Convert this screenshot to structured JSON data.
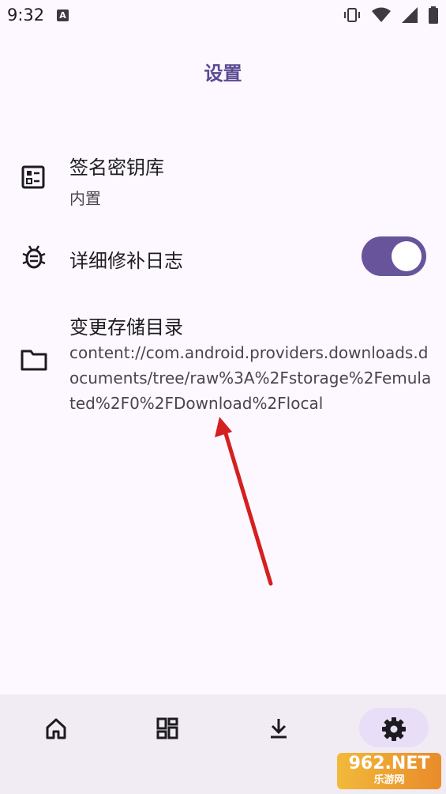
{
  "status_bar": {
    "time": "9:32",
    "notif_letter": "A"
  },
  "header": {
    "title": "设置"
  },
  "settings": [
    {
      "label": "签名密钥库",
      "value": "内置"
    },
    {
      "label": "详细修补日志",
      "toggle_on": true
    },
    {
      "label": "变更存储目录",
      "value": "content://com.android.providers.downloads.documents/tree/raw%3A%2Fstorage%2Femulated%2F0%2FDownload%2Flocal"
    }
  ],
  "bottom_nav": {
    "items": [
      "home-icon",
      "dashboard-icon",
      "download-icon",
      "settings-icon"
    ],
    "active": "settings"
  },
  "watermark": {
    "main": "962.NET",
    "sub": "乐游网"
  },
  "colors": {
    "accent": "#67549b",
    "title": "#5b4a93",
    "background": "#fdf7ff",
    "nav_bg": "#f1ecf4"
  }
}
